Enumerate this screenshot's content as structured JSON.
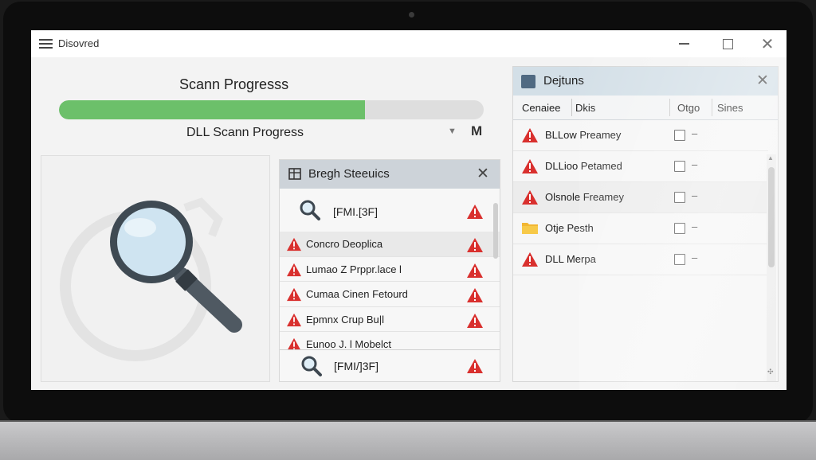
{
  "window": {
    "title": "Disovred"
  },
  "progress": {
    "heading": "Scann Progresss",
    "fraction": 0.72,
    "label": "DLL Scann Progress",
    "m_icon_text": "M"
  },
  "middle_panel": {
    "title": "Bregh Steeuics",
    "search_row_text": "[FMI.[3F]",
    "rows": [
      "Concro Deoplica",
      "Lumao Z Prppr.lace l",
      "Cumaa Cinen Fetourd",
      "Epmnx Crup Bu|l",
      "Eunoo J. l Mobelct"
    ],
    "footer_text": "[FMI/]3F]"
  },
  "right_panel": {
    "title": "Dejtuns",
    "columns": [
      "Cenaiee",
      "Dkis",
      "Otgo",
      "Sines"
    ],
    "rows": [
      {
        "icon": "warning-icon",
        "text": "BLLow Preamey"
      },
      {
        "icon": "warning-icon",
        "text": "DLLioo Petamed"
      },
      {
        "icon": "warning-icon",
        "text": "Olsnole Freamey"
      },
      {
        "icon": "folder-icon",
        "text": "Otje Pesth"
      },
      {
        "icon": "warning-icon",
        "text": "DLL Merpa"
      }
    ],
    "dash": "–"
  },
  "colors": {
    "progress_fill": "#6cc06a",
    "warning": "#d9302e",
    "panel_header": "#cdd3d9",
    "right_header": "#d3dfe7"
  }
}
